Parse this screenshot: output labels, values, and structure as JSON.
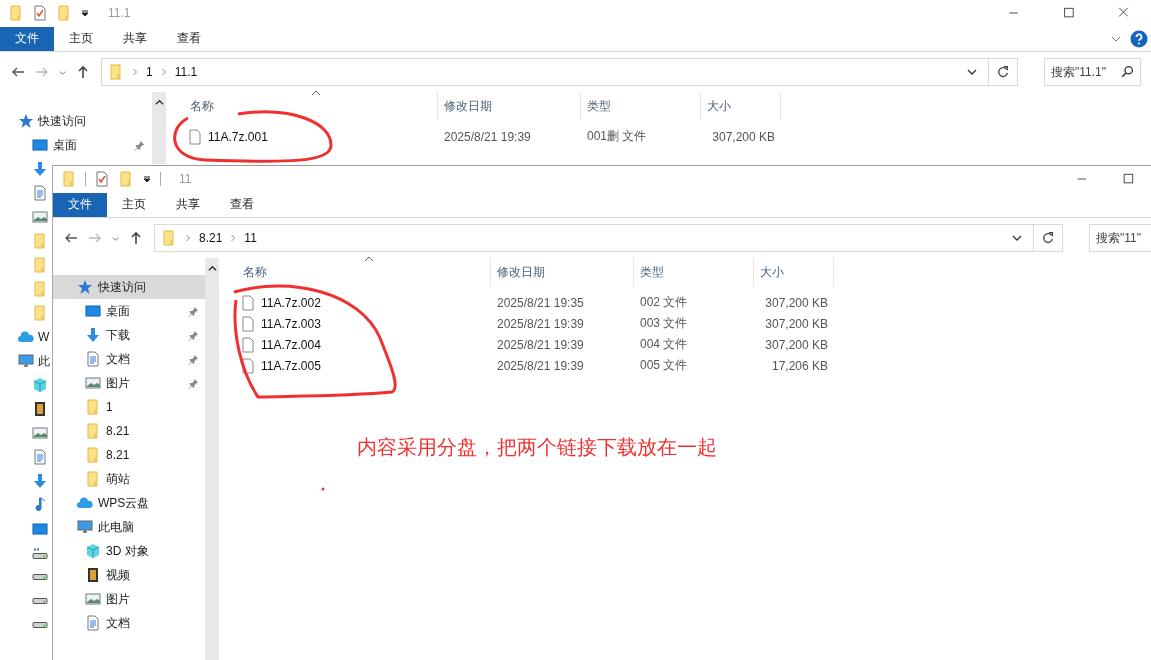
{
  "back_window": {
    "title": "11.1",
    "ribbon_tabs": [
      {
        "label": "文件",
        "selected": true
      },
      {
        "label": "主页",
        "selected": false
      },
      {
        "label": "共享",
        "selected": false
      },
      {
        "label": "查看",
        "selected": false
      }
    ],
    "breadcrumb": [
      "1",
      "11.1"
    ],
    "search": {
      "placeholder": "搜索\"11.1\""
    },
    "nav_items": [
      {
        "kind": "star",
        "label": "快速访问",
        "selected": false,
        "children": [
          {
            "kind": "desktop",
            "label": "桌面",
            "pinned": true
          },
          {
            "kind": "download"
          },
          {
            "kind": "document"
          },
          {
            "kind": "picture"
          },
          {
            "kind": "folder"
          },
          {
            "kind": "folder"
          },
          {
            "kind": "folder"
          },
          {
            "kind": "folder"
          }
        ]
      },
      {
        "kind": "cloud",
        "label": "W"
      },
      {
        "kind": "pc",
        "label": "此",
        "children": [
          {
            "kind": "cube"
          },
          {
            "kind": "video"
          },
          {
            "kind": "picture"
          },
          {
            "kind": "document"
          },
          {
            "kind": "download"
          },
          {
            "kind": "music"
          },
          {
            "kind": "desktop"
          },
          {
            "kind": "winDrive"
          },
          {
            "kind": "drive"
          },
          {
            "kind": "drive"
          },
          {
            "kind": "drive"
          }
        ]
      }
    ],
    "columns": [
      "名称",
      "修改日期",
      "类型",
      "大小"
    ],
    "files": [
      {
        "name": "11A.7z.001",
        "modified": "2025/8/21 19:39",
        "type": "001删 文件",
        "size": "307,200 KB"
      }
    ]
  },
  "front_window": {
    "title": "11",
    "ribbon_tabs": [
      {
        "label": "文件",
        "selected": true
      },
      {
        "label": "主页",
        "selected": false
      },
      {
        "label": "共享",
        "selected": false
      },
      {
        "label": "查看",
        "selected": false
      }
    ],
    "breadcrumb": [
      "8.21",
      "11"
    ],
    "search": {
      "placeholder": "搜索\"11\""
    },
    "nav_items": [
      {
        "kind": "star",
        "label": "快速访问",
        "selected": true,
        "children": [
          {
            "kind": "desktop",
            "label": "桌面",
            "pinned": true
          },
          {
            "kind": "download",
            "label": "下载",
            "pinned": true
          },
          {
            "kind": "document",
            "label": "文档",
            "pinned": true
          },
          {
            "kind": "picture",
            "label": "图片",
            "pinned": true
          },
          {
            "kind": "folder",
            "label": "1"
          },
          {
            "kind": "folder",
            "label": "8.21"
          },
          {
            "kind": "folder",
            "label": "8.21"
          },
          {
            "kind": "folder",
            "label": "萌站"
          }
        ]
      },
      {
        "kind": "cloud",
        "label": "WPS云盘"
      },
      {
        "kind": "pc",
        "label": "此电脑",
        "children": [
          {
            "kind": "cube",
            "label": "3D 对象"
          },
          {
            "kind": "video",
            "label": "视频"
          },
          {
            "kind": "picture",
            "label": "图片"
          },
          {
            "kind": "document",
            "label": "文档"
          }
        ]
      }
    ],
    "columns": [
      "名称",
      "修改日期",
      "类型",
      "大小"
    ],
    "files": [
      {
        "name": "11A.7z.002",
        "modified": "2025/8/21 19:35",
        "type": "002 文件",
        "size": "307,200 KB"
      },
      {
        "name": "11A.7z.003",
        "modified": "2025/8/21 19:39",
        "type": "003 文件",
        "size": "307,200 KB"
      },
      {
        "name": "11A.7z.004",
        "modified": "2025/8/21 19:39",
        "type": "004 文件",
        "size": "307,200 KB"
      },
      {
        "name": "11A.7z.005",
        "modified": "2025/8/21 19:39",
        "type": "005 文件",
        "size": "17,206 KB"
      }
    ]
  },
  "annotation": {
    "note": "内容采用分盘，把两个链接下载放在一起"
  }
}
